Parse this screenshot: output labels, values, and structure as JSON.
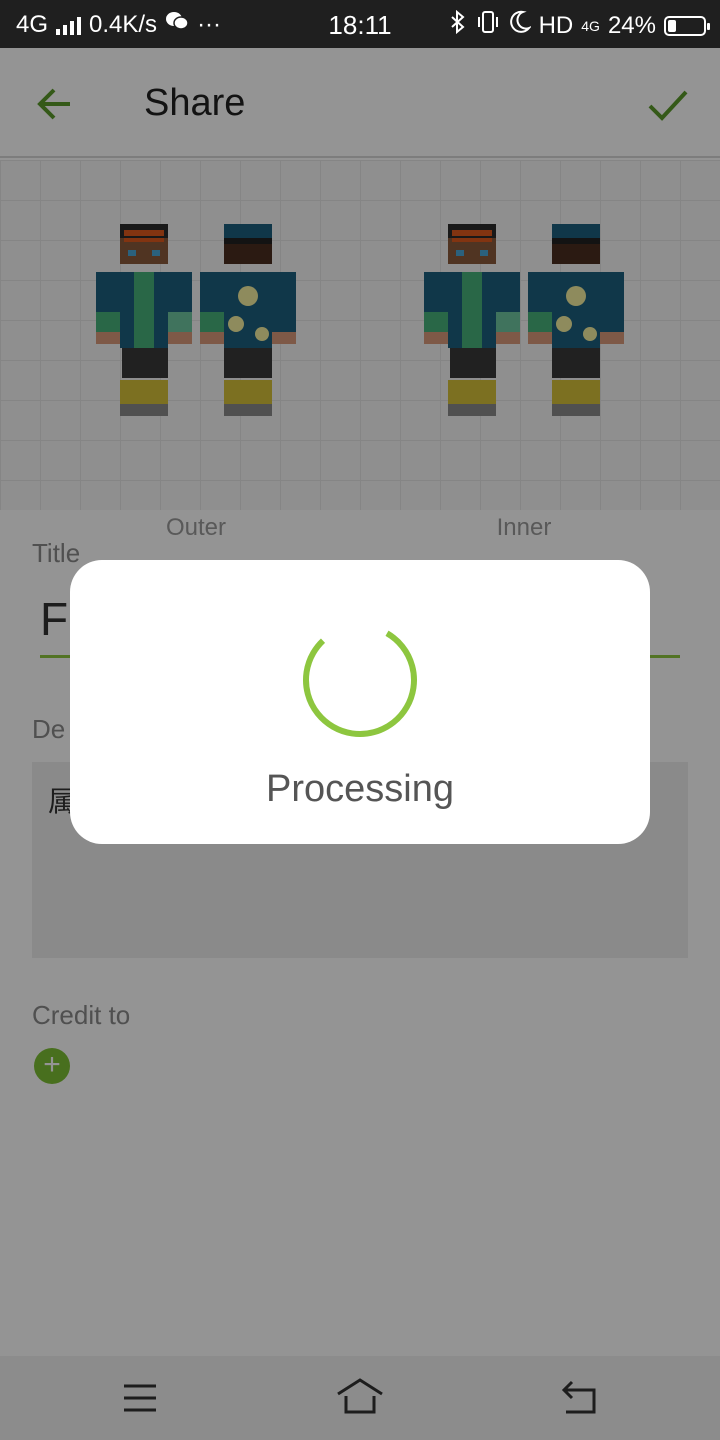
{
  "status_bar": {
    "network": "4G",
    "speed": "0.4K/s",
    "more": "···",
    "time": "18:11",
    "hd": "HD",
    "mobile": "4G",
    "battery": "24%",
    "battery_level": 0.24
  },
  "app_bar": {
    "title": "Share"
  },
  "skins": {
    "outer_label": "Outer",
    "inner_label": "Inner"
  },
  "form": {
    "title_label": "Title",
    "title_value": "F",
    "description_label": "De",
    "description_value": "属",
    "credit_label": "Credit to",
    "add_credit": "+"
  },
  "dialog": {
    "message": "Processing"
  },
  "colors": {
    "accent": "#8dc63f",
    "accent_dark": "#5a9a2a",
    "status_bar_bg": "#1f1f1f",
    "nav_bar_bg": "#f2f2f2"
  }
}
